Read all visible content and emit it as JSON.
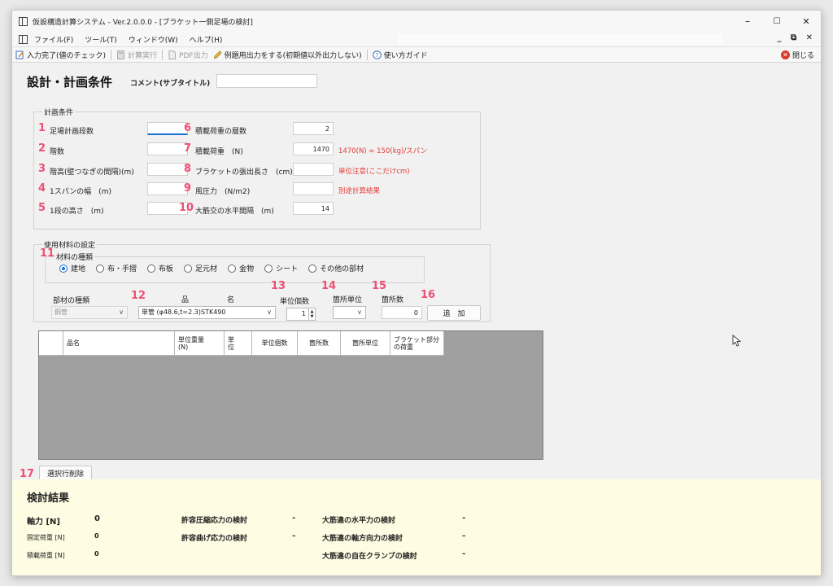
{
  "window": {
    "title": "仮設構造計算システム - Ver.2.0.0.0 - [ブラケット一側足場の検討]",
    "minimize": "–",
    "maximize": "☐",
    "close": "✕"
  },
  "menu": {
    "items": [
      "ファイル(F)",
      "ツール(T)",
      "ウィンドウ(W)",
      "ヘルプ(H)"
    ],
    "mdi_controls": "_ ⧉ ✕"
  },
  "toolbar": {
    "input_done": "入力完了(値のチェック)",
    "calc": "計算実行",
    "pdf": "PDF出力",
    "example": "例題用出力をする(初期値以外出力しない)",
    "guide": "使い方ガイド",
    "close": "閉じる"
  },
  "page": {
    "title": "設計・計画条件",
    "comment_label": "コメント(サブタイトル)",
    "comment_value": ""
  },
  "plan": {
    "group_label": "計画条件",
    "fields": [
      {
        "num": "1",
        "label": "足場計画段数",
        "value": ""
      },
      {
        "num": "2",
        "label": "階数",
        "value": ""
      },
      {
        "num": "3",
        "label": "階高(壁つなぎの間隔)(m)",
        "value": ""
      },
      {
        "num": "4",
        "label": "1スパンの幅　(m)",
        "value": ""
      },
      {
        "num": "5",
        "label": "1段の高さ　(m)",
        "value": ""
      },
      {
        "num": "6",
        "label": "積載荷重の層数",
        "value": "2"
      },
      {
        "num": "7",
        "label": "積載荷重　(N)",
        "value": "1470"
      },
      {
        "num": "8",
        "label": "ブラケットの張出長さ　(cm)",
        "value": ""
      },
      {
        "num": "9",
        "label": "風圧力　(N/m2)",
        "value": ""
      },
      {
        "num": "10",
        "label": "大筋交の水平間隔　(m)",
        "value": "14"
      }
    ],
    "note_load": "1470(N) = 150(kg)/スパン",
    "note_unit": "単位注意(ここだけcm)",
    "note_wind": "別途計算結果"
  },
  "material": {
    "group_label": "使用材料の設定",
    "kind_num": "11",
    "kind_label": "材料の種類",
    "radios": [
      "建地",
      "布・手摺",
      "布板",
      "足元材",
      "金物",
      "シート",
      "その他の部材"
    ],
    "selected": 0,
    "part_kind_label": "部材の種類",
    "part_kind_value": "鋼管",
    "name_num": "12",
    "name_label_1": "品",
    "name_label_2": "名",
    "name_value": "単管 (φ48.6,t=2.3)STK490",
    "unit_count_num": "13",
    "unit_count_label": "単位個数",
    "unit_count_value": "1",
    "place_unit_num": "14",
    "place_unit_label": "箇所単位",
    "place_unit_value": "",
    "place_count_num": "15",
    "place_count_label": "箇所数",
    "place_count_value": "0",
    "add_num": "16",
    "add_label": "追　加"
  },
  "grid": {
    "columns": [
      "",
      "品名",
      "単位重量\n(N)",
      "単\n位",
      "単位個数",
      "箇所数",
      "箇所単位",
      "ブラケット部分\nの荷重"
    ]
  },
  "delete": {
    "num": "17",
    "label": "選択行削除"
  },
  "results": {
    "title": "検討結果",
    "axial_label": "軸力 [N]",
    "axial_value": "0",
    "fixed_label": "固定荷重 [N]",
    "fixed_value": "0",
    "load_label": "積載荷重 [N]",
    "load_value": "0",
    "checks": [
      {
        "label": "許容圧縮応力の検討",
        "value": "–"
      },
      {
        "label": "許容曲げ応力の検討",
        "value": "–"
      },
      {
        "label": "大筋違の水平力の検討",
        "value": "–"
      },
      {
        "label": "大筋違の軸方向力の検討",
        "value": "–"
      },
      {
        "label": "大筋違の自在クランプの検討",
        "value": "–"
      }
    ]
  }
}
